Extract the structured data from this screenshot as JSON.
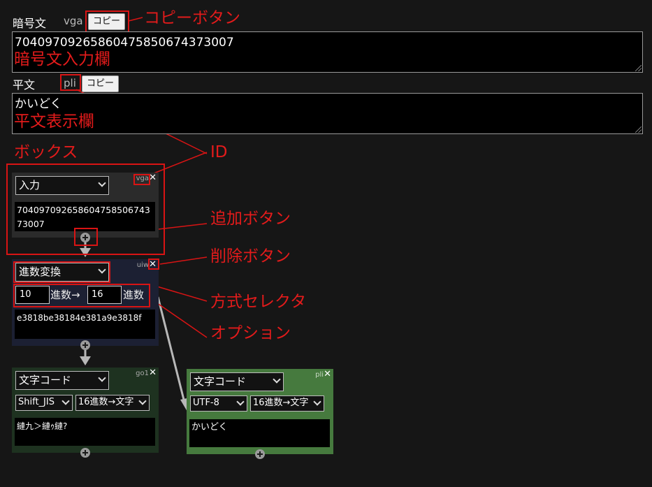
{
  "cipher": {
    "label": "暗号文",
    "id": "vga",
    "copy_label": "コピー",
    "value": "70409709265860475850674373007"
  },
  "plain": {
    "label": "平文",
    "id": "pli",
    "copy_label": "コピー",
    "value": "かいどく"
  },
  "nodes": {
    "input": {
      "id": "vga",
      "method": "入力",
      "output": "70409709265860475850674373007"
    },
    "radix": {
      "id": "uiw",
      "method": "進数変換",
      "from": "10",
      "from_suffix": "進数→",
      "to": "16",
      "to_suffix": "進数",
      "output": "e3818be38184e381a9e3818f"
    },
    "charcode_sjis": {
      "id": "go1",
      "method": "文字コード",
      "encoding": "Shift_JIS",
      "direction": "16進数→文字",
      "output": "縺九＞縺ｩ縺?"
    },
    "charcode_utf8": {
      "id": "pli",
      "method": "文字コード",
      "encoding": "UTF-8",
      "direction": "16進数→文字",
      "output": "かいどく"
    }
  },
  "annotations": {
    "copy_button": "コピーボタン",
    "cipher_field": "暗号文入力欄",
    "plain_field": "平文表示欄",
    "box": "ボックス",
    "id": "ID",
    "add_button": "追加ボタン",
    "delete_button": "削除ボタン",
    "method_selector": "方式セレクタ",
    "option": "オプション"
  },
  "colors": {
    "page_bg": "#161616",
    "annotation_red": "#e31b1b",
    "input_node_bg": "#2b2b2b",
    "radix_node_bg": "#1c2033",
    "sjis_node_bg": "#1e3220",
    "utf8_node_bg": "#467a3e"
  }
}
